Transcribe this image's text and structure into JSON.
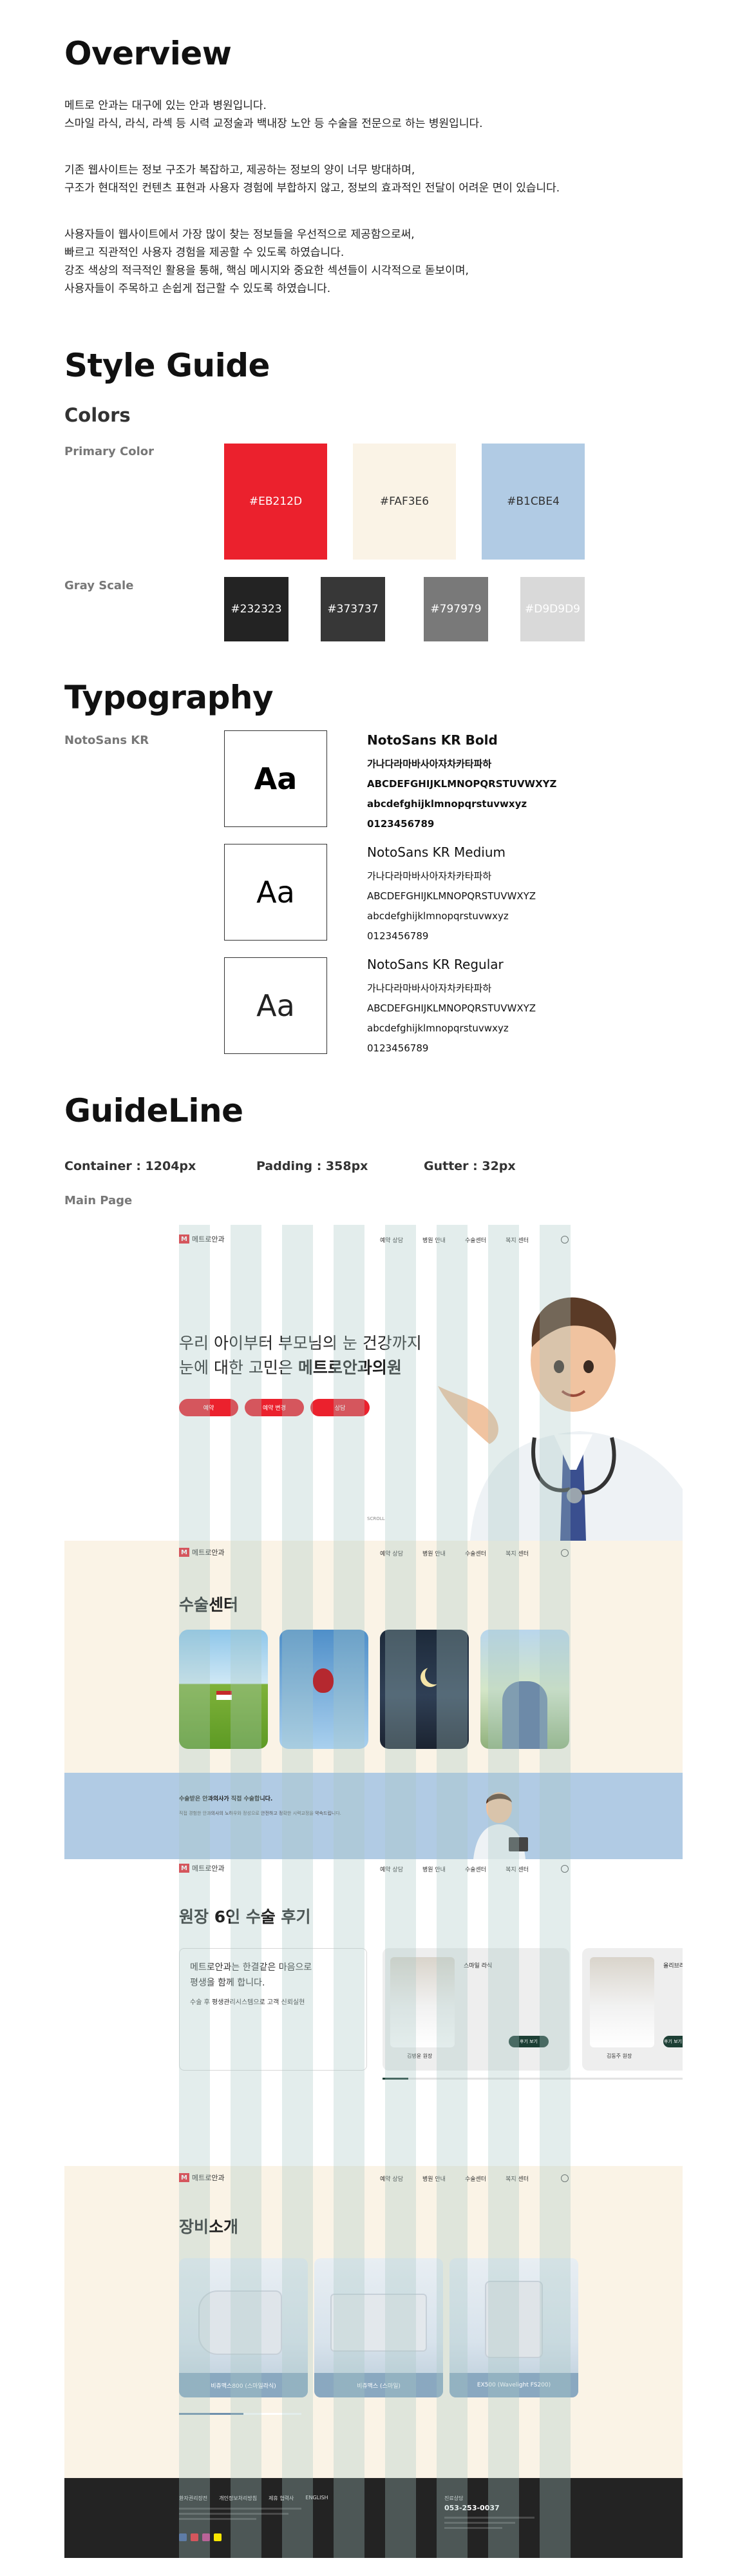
{
  "overview": {
    "title": "Overview",
    "p1": [
      "메트로 안과는 대구에 있는 안과 병원입니다.",
      "스마일 라식, 라식, 라섹 등 시력 교정술과 백내장 노안 등 수술을 전문으로 하는 병원입니다."
    ],
    "p2": [
      "기존 웹사이트는 정보 구조가 복잡하고, 제공하는 정보의 양이 너무 방대하며,",
      "구조가 현대적인 컨텐츠 표현과 사용자 경험에 부합하지 않고, 정보의 효과적인 전달이 어려운 면이 있습니다."
    ],
    "p3": [
      "사용자들이 웹사이트에서 가장 많이 찾는 정보들을 우선적으로 제공함으로써,",
      "빠르고 직관적인 사용자 경험을 제공할 수 있도록 하였습니다.",
      "강조 색상의 적극적인 활용을 통해, 핵심 메시지와 중요한 섹션들이 시각적으로 돋보이며,",
      "사용자들이 주목하고 손쉽게 접근할 수 있도록 하였습니다."
    ]
  },
  "style_guide": {
    "title": "Style Guide",
    "colors_heading": "Colors",
    "primary_label": "Primary Color",
    "primary": [
      {
        "hex": "#EB212D",
        "label": "#EB212D",
        "text_color": "#ffffff"
      },
      {
        "hex": "#FAF3E6",
        "label": "#FAF3E6",
        "text_color": "#333333"
      },
      {
        "hex": "#B1CBE4",
        "label": "#B1CBE4",
        "text_color": "#333333"
      }
    ],
    "gray_label": "Gray Scale",
    "gray": [
      {
        "hex": "#232323",
        "label": "#232323",
        "text_color": "#ffffff"
      },
      {
        "hex": "#373737",
        "label": "#373737",
        "text_color": "#ffffff"
      },
      {
        "hex": "#797979",
        "label": "#797979",
        "text_color": "#ffffff"
      },
      {
        "hex": "#D9D9D9",
        "label": "#D9D9D9",
        "text_color": "#ffffff"
      }
    ]
  },
  "typography": {
    "title": "Typography",
    "font_label": "NotoSans KR",
    "sample": "Aa",
    "weights": [
      {
        "name": "NotoSans KR Bold",
        "hangul": "가나다라마바사아자차카타파하",
        "upper": "ABCDEFGHIJKLMNOPQRSTUVWXYZ",
        "lower": "abcdefghijklmnopqrstuvwxyz",
        "digits": "0123456789"
      },
      {
        "name": "NotoSans KR Medium",
        "hangul": "가나다라마바사아자차카타파하",
        "upper": "ABCDEFGHIJKLMNOPQRSTUVWXYZ",
        "lower": "abcdefghijklmnopqrstuvwxyz",
        "digits": "0123456789"
      },
      {
        "name": "NotoSans KR Regular",
        "hangul": "가나다라마바사아자차카타파하",
        "upper": "ABCDEFGHIJKLMNOPQRSTUVWXYZ",
        "lower": "abcdefghijklmnopqrstuvwxyz",
        "digits": "0123456789"
      }
    ]
  },
  "guideline": {
    "title": "GuideLine",
    "container": "Container : 1204px",
    "padding": "Padding : 358px",
    "gutter": "Gutter : 32px",
    "main_page": "Main Page"
  },
  "mockup": {
    "logo_text": "메트로안과",
    "nav": [
      "예약 상담",
      "병원 안내",
      "수술센터",
      "복지 센터"
    ],
    "hero": {
      "line1": "우리 아이부터 부모님의 눈 건강까지",
      "line2_prefix": "눈에 대한 고민은 ",
      "line2_bold": "메트로안과의원",
      "buttons": [
        "예약",
        "예약 변경",
        "상담"
      ],
      "scroll": "SCROLL"
    },
    "surgery": {
      "title": "수술센터",
      "banner_title": "수술받은 안과의사가 직접 수술합니다.",
      "banner_text": [
        "직접 경험한 안과의사의 노하우와 정성으로 안전하고 정확한 시력교정을 약속드립니다.",
        "",
        ""
      ]
    },
    "reviews": {
      "title": "원장 6인 수술 후기",
      "intro1": "메트로안과는 한결같은 마음으로",
      "intro2": "평생을 함께 합니다.",
      "intro3": "수술 후 평생관리시스템으로 고객 신뢰실현",
      "doctors": [
        {
          "role": "스마일 라식",
          "name": "김병윤 원장",
          "button": "후기 보기"
        },
        {
          "role": "올리브라식",
          "name": "김동주 원장",
          "button": "후기 보기"
        }
      ]
    },
    "equipment": {
      "title": "장비소개",
      "items": [
        "비쥬맥스800 (스마일라식)",
        "비쥬맥스 (스마일)",
        "EX500 (Wavelight FS200)"
      ]
    },
    "footer": {
      "links": [
        "환자권리장전",
        "개인정보처리방침",
        "제휴 협력사",
        "ENGLISH"
      ],
      "phone_label": "진료상담",
      "phone": "053-253-0037"
    }
  }
}
